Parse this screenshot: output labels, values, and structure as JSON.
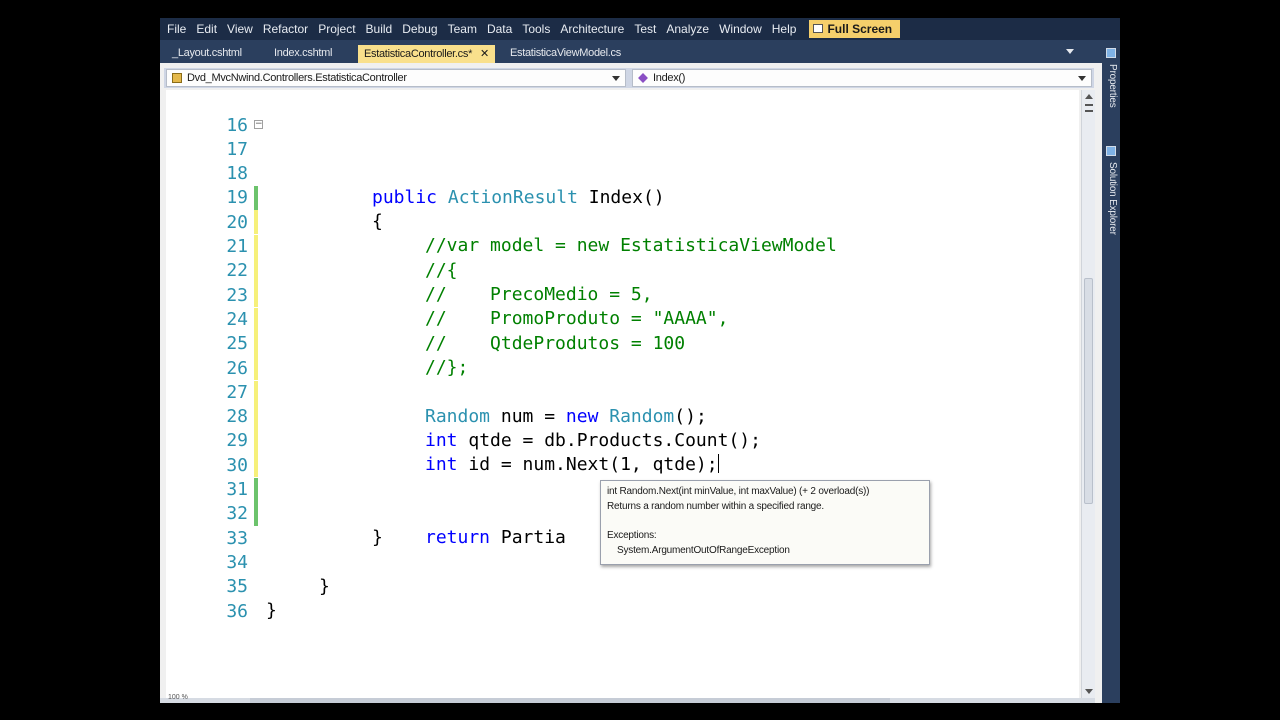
{
  "menu": [
    "File",
    "Edit",
    "View",
    "Refactor",
    "Project",
    "Build",
    "Debug",
    "Team",
    "Data",
    "Tools",
    "Architecture",
    "Test",
    "Analyze",
    "Window",
    "Help"
  ],
  "menu_fullscreen": "Full Screen",
  "tabs": [
    {
      "label": "_Layout.cshtml"
    },
    {
      "label": "Index.cshtml"
    },
    {
      "label": "EstatisticaController.cs*"
    },
    {
      "label": "EstatisticaViewModel.cs"
    }
  ],
  "tab_close": "✕",
  "nav": {
    "class": "Dvd_MvcNwind.Controllers.EstatisticaController",
    "member": "Index()"
  },
  "lines": {
    "l16": "16",
    "l17": "17",
    "l18": "18",
    "l19": "19",
    "l20": "20",
    "l21": "21",
    "l22": "22",
    "l23": "23",
    "l24": "24",
    "l25": "25",
    "l26": "26",
    "l27": "27",
    "l28": "28",
    "l29": "29",
    "l30": "30",
    "l31": "31",
    "l32": "32",
    "l33": "33",
    "l34": "34",
    "l35": "35",
    "l36": "36"
  },
  "code": {
    "public": "public",
    "ActionResult": "ActionResult",
    "index_sig": " Index()",
    "open_brace": "{",
    "close_brace": "}",
    "c19": "//var model = new EstatisticaViewModel",
    "c20": "//{",
    "c21": "//    PrecoMedio = 5,",
    "c22": "//    PromoProduto = \"AAAA\",",
    "c23": "//    QtdeProdutos = 100",
    "c24": "//};",
    "Random": "Random",
    "num_eq": " num = ",
    "new": "new",
    "space": " ",
    "ctor_call": "();",
    "int": "int",
    "l27_rest": " qtde = db.Products.Count();",
    "l28_rest": " id = num.Next(1, qtde);",
    "return": "return",
    "l31_rest": " Partia"
  },
  "tooltip": {
    "signature": "int Random.Next(int minValue, int maxValue)  (+ 2 overload(s))",
    "description": "Returns a random number within a specified range.",
    "exceptions_label": "Exceptions:",
    "exception": "System.ArgumentOutOfRangeException"
  },
  "zoom": "100 %",
  "dock": {
    "properties": "Properties",
    "solution_explorer": "Solution Explorer"
  },
  "colors": {
    "keyword": "#0000ff",
    "type": "#2b91af",
    "comment": "#008000",
    "line_number": "#2b91af",
    "saved_change": "#6cc36c",
    "unsaved_change": "#f6f07a",
    "active_tab": "#f9e08c",
    "menu_bar": "#1c2c46"
  }
}
